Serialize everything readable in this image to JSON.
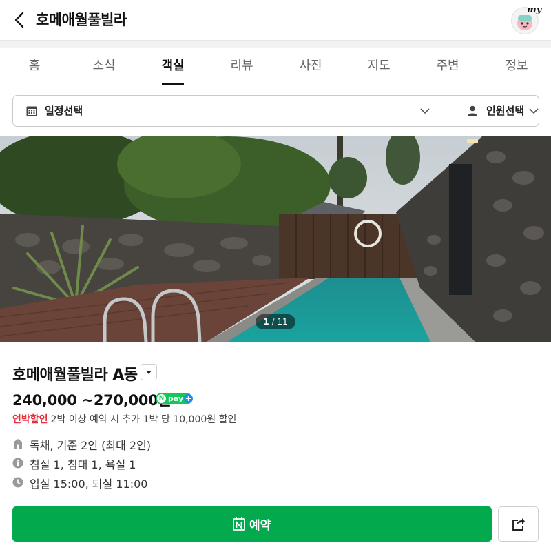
{
  "header": {
    "title": "호메애월풀빌라",
    "my_label": "my"
  },
  "tabs": [
    {
      "label": "홈",
      "active": false
    },
    {
      "label": "소식",
      "active": false
    },
    {
      "label": "객실",
      "active": true
    },
    {
      "label": "리뷰",
      "active": false
    },
    {
      "label": "사진",
      "active": false
    },
    {
      "label": "지도",
      "active": false
    },
    {
      "label": "주변",
      "active": false
    },
    {
      "label": "정보",
      "active": false
    }
  ],
  "selector": {
    "date_label": "일정선택",
    "people_label": "인원선택"
  },
  "photo": {
    "current": "1",
    "separator": "/",
    "total": "11"
  },
  "room": {
    "name": "호메애월풀빌라 A동",
    "price": "240,000 ~270,000원",
    "npay_label": "pay",
    "discount_label": "연박할인",
    "discount_text": "2박 이상 예약 시 추가 1박 당 10,000원 할인",
    "details": [
      {
        "icon": "house-icon",
        "text": "독채, 기준 2인 (최대 2인)"
      },
      {
        "icon": "info-icon",
        "text": "침실 1, 침대 1, 욕실 1"
      },
      {
        "icon": "clock-icon",
        "text": "입실 15:00, 퇴실 11:00"
      }
    ]
  },
  "actions": {
    "reserve_label": "예약",
    "share_icon": "share-icon"
  },
  "colors": {
    "accent_green": "#03a94d",
    "discount_red": "#e5303d",
    "npay_green": "#13c75b"
  }
}
